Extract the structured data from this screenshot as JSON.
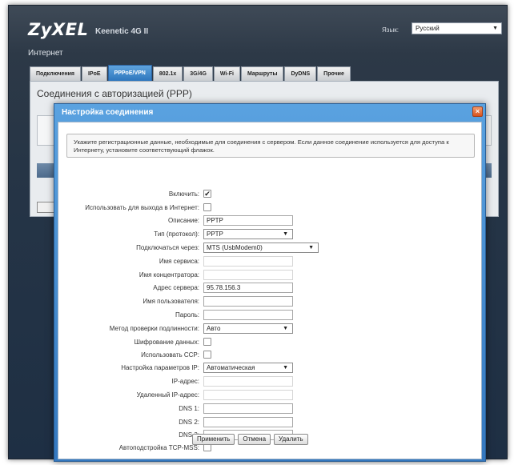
{
  "header": {
    "logo": "ZyXEL",
    "model": "Keenetic 4G II",
    "language_label": "Язык:",
    "language_value": "Русский",
    "section_title": "Интернет"
  },
  "tabs": [
    {
      "label": "Подключения",
      "active": false
    },
    {
      "label": "IPoE",
      "active": false
    },
    {
      "label": "PPPoE/VPN",
      "active": true
    },
    {
      "label": "802.1x",
      "active": false
    },
    {
      "label": "3G/4G",
      "active": false
    },
    {
      "label": "Wi-Fi",
      "active": false
    },
    {
      "label": "Маршруты",
      "active": false
    },
    {
      "label": "DyDNS",
      "active": false
    },
    {
      "label": "Прочие",
      "active": false
    }
  ],
  "background": {
    "title": "Соединения с авторизацией (PPP)"
  },
  "dialog": {
    "title": "Настройка соединения",
    "close_icon": "×",
    "notice": "Укажите регистрационные данные, необходимые для соединения с сервером. Если данное соединение используется для доступа к Интернету, установите соответствующий флажок.",
    "fields": {
      "enable": {
        "label": "Включить:",
        "checked": true
      },
      "use_internet": {
        "label": "Использовать для выхода в Интернет:",
        "checked": false
      },
      "description": {
        "label": "Описание:",
        "value": "PPTP"
      },
      "protocol": {
        "label": "Тип (протокол):",
        "value": "PPTP"
      },
      "connect_via": {
        "label": "Подключаться через:",
        "value": "MTS (UsbModem0)"
      },
      "service_name": {
        "label": "Имя сервиса:",
        "value": ""
      },
      "concentrator": {
        "label": "Имя концентратора:",
        "value": ""
      },
      "server_address": {
        "label": "Адрес сервера:",
        "value": "95.78.156.3"
      },
      "username": {
        "label": "Имя пользователя:",
        "value": ""
      },
      "password": {
        "label": "Пароль:",
        "value": ""
      },
      "auth_method": {
        "label": "Метод проверки подлинности:",
        "value": "Авто"
      },
      "encryption": {
        "label": "Шифрование данных:",
        "checked": false
      },
      "use_ccp": {
        "label": "Использовать CCP:",
        "checked": false
      },
      "ip_settings": {
        "label": "Настройка параметров IP:",
        "value": "Автоматическая"
      },
      "ip_address": {
        "label": "IP-адрес:",
        "value": ""
      },
      "remote_ip": {
        "label": "Удаленный IP-адрес:",
        "value": ""
      },
      "dns1": {
        "label": "DNS 1:",
        "value": ""
      },
      "dns2": {
        "label": "DNS 2:",
        "value": ""
      },
      "dns3": {
        "label": "DNS 3:",
        "value": ""
      },
      "tcp_mss": {
        "label": "Автоподстройка TCP-MSS:",
        "checked": false
      }
    },
    "buttons": {
      "apply": "Применить",
      "cancel": "Отмена",
      "delete": "Удалить"
    }
  }
}
